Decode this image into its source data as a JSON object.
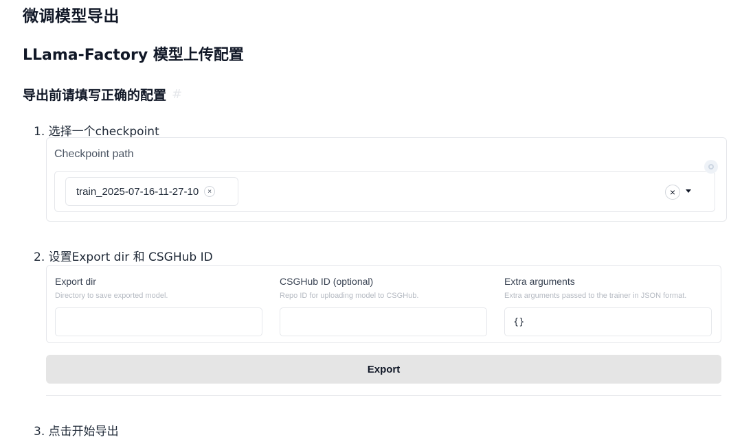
{
  "headings": {
    "title": "微调模型导出",
    "subtitle": "LLama-Factory 模型上传配置",
    "section": "导出前请填写正确的配置",
    "section_anchor": "#"
  },
  "steps": {
    "step1": "1. 选择一个checkpoint",
    "step2": "2. 设置Export dir 和 CSGHub ID",
    "step3": "3. 点击开始导出"
  },
  "checkpoint": {
    "label": "Checkpoint path",
    "selected": "train_2025-07-16-11-27-10",
    "chip_remove": "×",
    "clear_all": "×"
  },
  "fields": {
    "export_dir": {
      "label": "Export dir",
      "info": "Directory to save exported model.",
      "value": ""
    },
    "csghub_id": {
      "label": "CSGHub ID (optional)",
      "info": "Repo ID for uploading model to CSGHub.",
      "value": ""
    },
    "extra_args": {
      "label": "Extra arguments",
      "info": "Extra arguments passed to the trainer in JSON format.",
      "value": "{}"
    }
  },
  "export_button": "Export"
}
